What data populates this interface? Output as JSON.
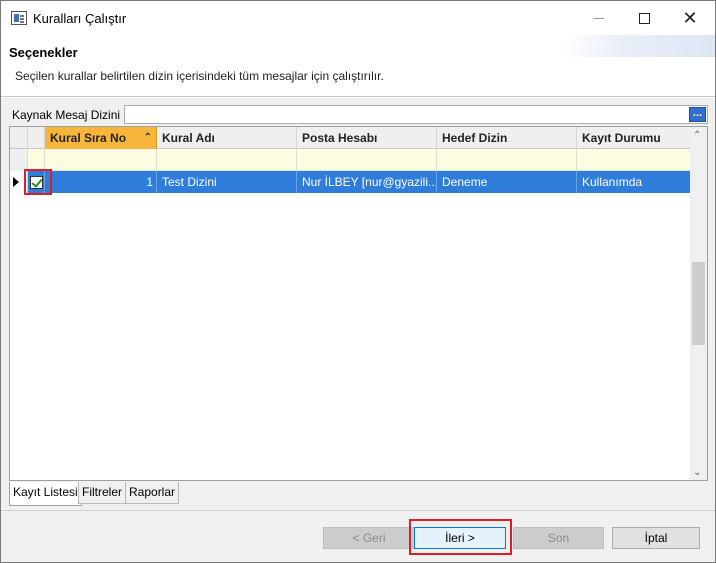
{
  "window": {
    "title": "Kuralları Çalıştır",
    "minimize_icon": "minimize-icon",
    "maximize_icon": "maximize-icon",
    "close_icon": "close-icon",
    "close_glyph": "✕"
  },
  "header": {
    "title": "Seçenekler",
    "description": "Seçilen kurallar belirtilen dizin içerisindeki tüm mesajlar için çalıştırılır."
  },
  "source": {
    "label": "Kaynak Mesaj Dizini",
    "value": "",
    "browse_label": "..."
  },
  "grid": {
    "columns": [
      {
        "label": "Kural Sıra No",
        "sorted": true
      },
      {
        "label": "Kural Adı"
      },
      {
        "label": "Posta Hesabı"
      },
      {
        "label": "Hedef Dizin"
      },
      {
        "label": "Kayıt Durumu"
      }
    ],
    "sort_glyph": "⌃",
    "rows": [
      {
        "selected": true,
        "checked": true,
        "cells": [
          "1",
          "Test Dizini",
          "Nur İLBEY [nur@gyazili...",
          "Deneme",
          "Kullanımda"
        ]
      }
    ],
    "scroll_up_glyph": "⌃",
    "scroll_down_glyph": "⌄"
  },
  "tabs": [
    {
      "label": "Kayıt Listesi",
      "active": true
    },
    {
      "label": "Filtreler"
    },
    {
      "label": "Raporlar"
    }
  ],
  "buttons": {
    "back": "< Geri",
    "next": "İleri >",
    "finish": "Son",
    "cancel": "İptal"
  },
  "colors": {
    "selection": "#2f7ddb",
    "sorted_header": "#f7b63b",
    "filter_row": "#fefde2",
    "highlight": "#e01b2a"
  }
}
